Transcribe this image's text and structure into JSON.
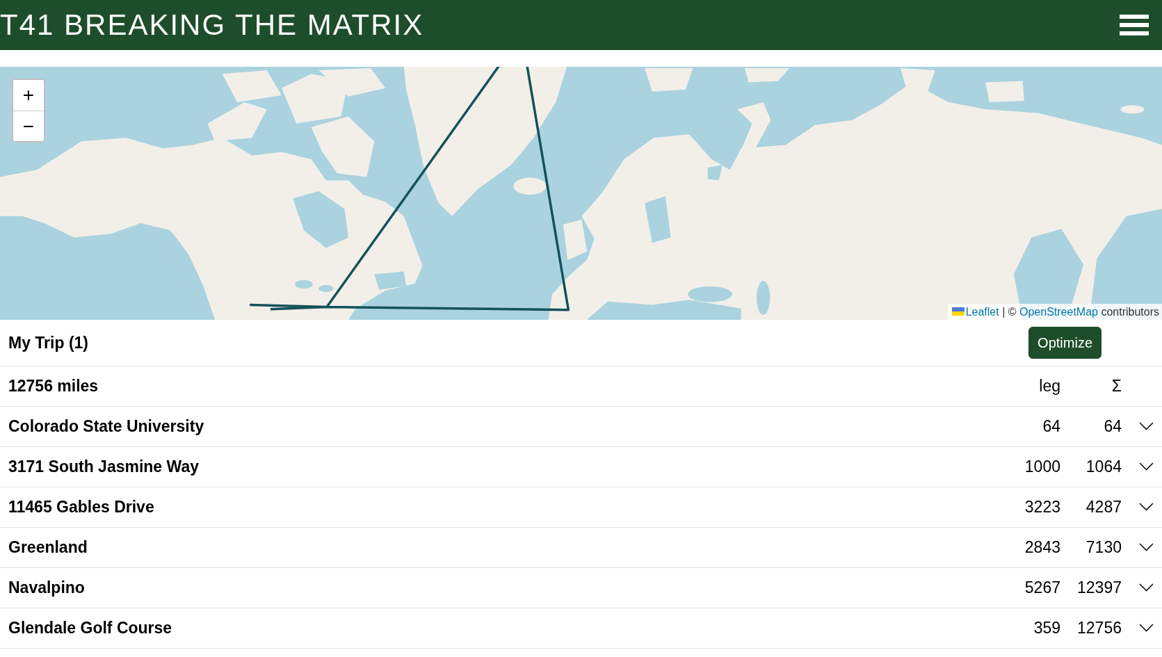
{
  "navbar": {
    "title": "T41 BREAKING THE MATRIX"
  },
  "map": {
    "zoom_in": "+",
    "zoom_out": "−",
    "attribution": {
      "link_1": "Leaflet",
      "separator": "| ©",
      "link_2": "OpenStreetMap",
      "text": "contributors"
    }
  },
  "trip": {
    "title": "My Trip (1)",
    "optimize_button": "Optimize",
    "distance": "12756 miles",
    "columns": [
      "leg",
      "Σ"
    ],
    "places": [
      {
        "name": "Colorado State University",
        "leg": "64",
        "total": "64",
        "expanded": false
      },
      {
        "name": "3171 South Jasmine Way",
        "leg": "1000",
        "total": "1064",
        "expanded": false
      },
      {
        "name": "11465 Gables Drive",
        "leg": "3223",
        "total": "4287",
        "expanded": false
      },
      {
        "name": "Greenland",
        "leg": "2843",
        "total": "7130",
        "expanded": false
      },
      {
        "name": "Navalpino",
        "leg": "5267",
        "total": "12397",
        "expanded": false
      },
      {
        "name": "Glendale Golf Course",
        "leg": "359",
        "total": "12756",
        "expanded": false
      }
    ]
  }
}
